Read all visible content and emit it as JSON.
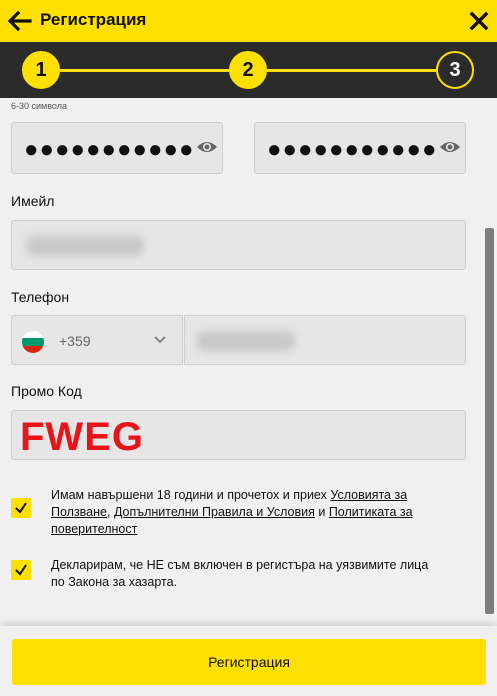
{
  "header": {
    "title": "Регистрация"
  },
  "stepper": {
    "steps": [
      "1",
      "2",
      "3"
    ],
    "current_step": 3
  },
  "password": {
    "hint": "6-30 символа",
    "value_mask": "●●●●●●●●●●●",
    "confirm_mask": "●●●●●●●●●●●"
  },
  "email": {
    "label": "Имейл"
  },
  "phone": {
    "label": "Телефон",
    "country_code": "+359"
  },
  "promo": {
    "label": "Промо Код",
    "value": "FWEG"
  },
  "consents": {
    "age": {
      "text_before": "Имам навършени 18 години и прочетох и приех ",
      "link1": "Условията за Ползване",
      "sep1": ", ",
      "link2": "Допълнителни Правила и Условия",
      "sep2": " и ",
      "link3": "Политиката за поверителност"
    },
    "declaration": {
      "text": "Декларирам, че НЕ съм включен в регистъра на уязвимите лица по Закона за хазарта."
    }
  },
  "submit": {
    "label": "Регистрация"
  },
  "colors": {
    "brand_yellow": "#fde000",
    "dark": "#2b2b2b",
    "promo_red": "#e8141a"
  }
}
